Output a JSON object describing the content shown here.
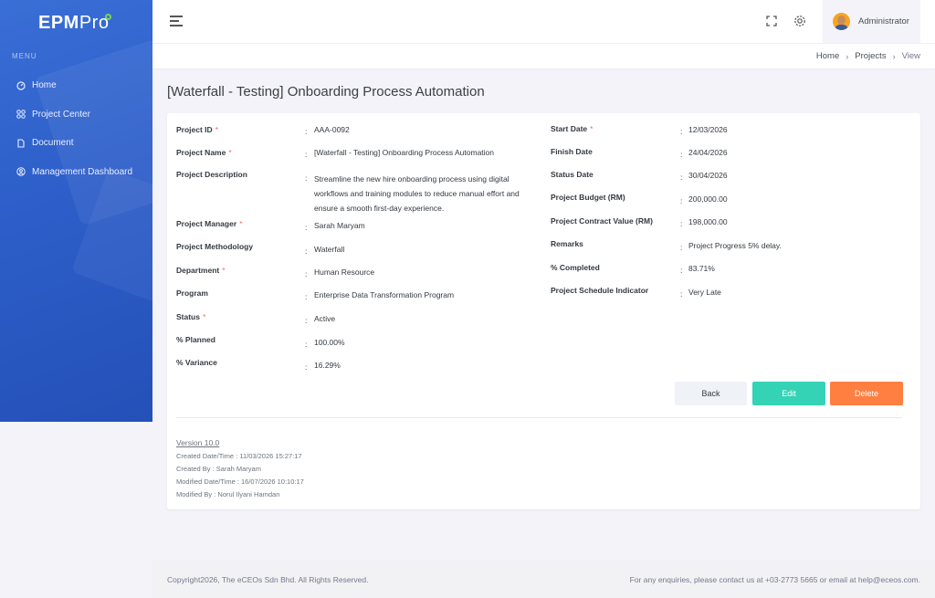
{
  "app": {
    "logo_main": "EPM",
    "logo_suffix": "Pro"
  },
  "sidebar": {
    "menu_title": "MENU",
    "items": [
      {
        "label": "Home",
        "icon": "dashboard-icon"
      },
      {
        "label": "Project Center",
        "icon": "grid-icon"
      },
      {
        "label": "Document",
        "icon": "document-icon"
      },
      {
        "label": "Management Dashboard",
        "icon": "user-circle-icon"
      }
    ]
  },
  "topbar": {
    "username": "Administrator"
  },
  "breadcrumb": {
    "home": "Home",
    "projects": "Projects",
    "current": "View"
  },
  "page": {
    "title": "[Waterfall - Testing] Onboarding Process Automation"
  },
  "details_left": [
    {
      "label": "Project ID",
      "required": true,
      "value": "AAA-0092"
    },
    {
      "label": "Project Name",
      "required": true,
      "value": "[Waterfall - Testing] Onboarding Process Automation"
    },
    {
      "label": "Project Description",
      "required": false,
      "value": "Streamline the new hire onboarding process using digital workflows and training modules to reduce manual effort and ensure a smooth first-day experience."
    },
    {
      "label": "Project Manager",
      "required": true,
      "value": "Sarah Maryam"
    },
    {
      "label": "Project Methodology",
      "required": false,
      "value": "Waterfall"
    },
    {
      "label": "Department",
      "required": true,
      "value": "Human Resource"
    },
    {
      "label": "Program",
      "required": false,
      "value": "Enterprise Data Transformation Program"
    },
    {
      "label": "Status",
      "required": true,
      "value": "Active"
    },
    {
      "label": "% Planned",
      "required": false,
      "value": "100.00%"
    },
    {
      "label": "% Variance",
      "required": false,
      "value": "16.29%"
    }
  ],
  "details_right": [
    {
      "label": "Start Date",
      "required": true,
      "value": "12/03/2026"
    },
    {
      "label": "Finish Date",
      "required": false,
      "value": "24/04/2026"
    },
    {
      "label": "Status Date",
      "required": false,
      "value": "30/04/2026"
    },
    {
      "label": "Project Budget (RM)",
      "required": false,
      "value": "200,000.00"
    },
    {
      "label": "Project Contract Value (RM)",
      "required": false,
      "value": "198,000.00"
    },
    {
      "label": "Remarks",
      "required": false,
      "value": "Project Progress 5% delay."
    },
    {
      "label": "% Completed",
      "required": false,
      "value": "83.71%"
    },
    {
      "label": "Project Schedule Indicator",
      "required": false,
      "value": "Very Late"
    }
  ],
  "actions": {
    "back": "Back",
    "edit": "Edit",
    "delete": "Delete"
  },
  "meta": {
    "version": "Version 10.0",
    "created_datetime": "Created Date/Time : 11/03/2026 15:27:17",
    "created_by": "Created By : Sarah Maryam",
    "modified_datetime": "Modified Date/Time : 16/07/2026 10:10:17",
    "modified_by": "Modified By : Norul Ilyani Hamdan"
  },
  "footer": {
    "copyright": "Copyright2026, The eCEOs Sdn Bhd. All Rights Reserved.",
    "contact": "For any enquiries, please contact us at +03-2773 5665 or email at help@eceos.com."
  }
}
